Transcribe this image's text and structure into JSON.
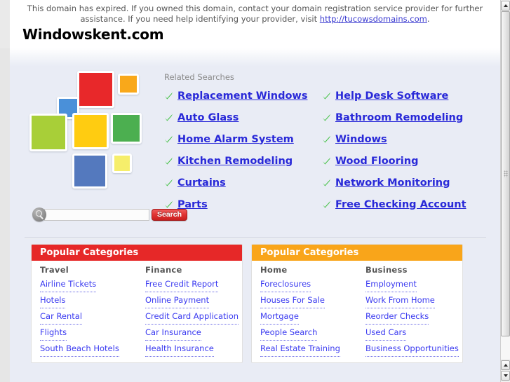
{
  "notice": {
    "text_before_link": "This domain has expired. If you owned this domain, contact your domain registration service provider for further assistance. If you need help identifying your provider, visit ",
    "link_text": "http://tucowsdomains.com",
    "text_after_link": "."
  },
  "header": {
    "domain_title": "Windowskent.com"
  },
  "logo": {
    "squares": [
      {
        "color": "#E8282A"
      },
      {
        "color": "#F9A81A"
      },
      {
        "color": "#4A90D9"
      },
      {
        "color": "#A8CF38"
      },
      {
        "color": "#FFCC11"
      },
      {
        "color": "#4CAF50"
      },
      {
        "color": "#5479BE"
      },
      {
        "color": "#F6EE6B"
      }
    ]
  },
  "search": {
    "value": "",
    "placeholder": "",
    "button_label": "Search",
    "icon": "magnifier-icon"
  },
  "related": {
    "label": "Related Searches",
    "columns": [
      {
        "items": [
          "Replacement Windows",
          "Auto Glass",
          "Home Alarm System",
          "Kitchen Remodeling",
          "Curtains",
          "Parts"
        ]
      },
      {
        "items": [
          "Help Desk Software",
          "Bathroom Remodeling",
          "Windows",
          "Wood Flooring",
          "Network Monitoring",
          "Free Checking Account"
        ]
      }
    ]
  },
  "categories": [
    {
      "title": "Popular Categories",
      "accent": "#E62828",
      "columns": [
        {
          "heading": "Travel",
          "links": [
            "Airline Tickets",
            "Hotels",
            "Car Rental",
            "Flights",
            "South Beach Hotels"
          ]
        },
        {
          "heading": "Finance",
          "links": [
            "Free Credit Report",
            "Online Payment",
            "Credit Card Application",
            "Car Insurance",
            "Health Insurance"
          ]
        }
      ]
    },
    {
      "title": "Popular Categories",
      "accent": "#F9A51A",
      "columns": [
        {
          "heading": "Home",
          "links": [
            "Foreclosures",
            "Houses For Sale",
            "Mortgage",
            "People Search",
            "Real Estate Training"
          ]
        },
        {
          "heading": "Business",
          "links": [
            "Employment",
            "Work From Home",
            "Reorder Checks",
            "Used Cars",
            "Business Opportunities"
          ]
        }
      ]
    }
  ],
  "scrollbar": {
    "up_icon": "triangle-up-icon",
    "down_icon": "triangle-down-icon"
  },
  "colors": {
    "link": "#2929D8",
    "check": "#3BBF3B",
    "page_bg": "#E9ECF5"
  }
}
